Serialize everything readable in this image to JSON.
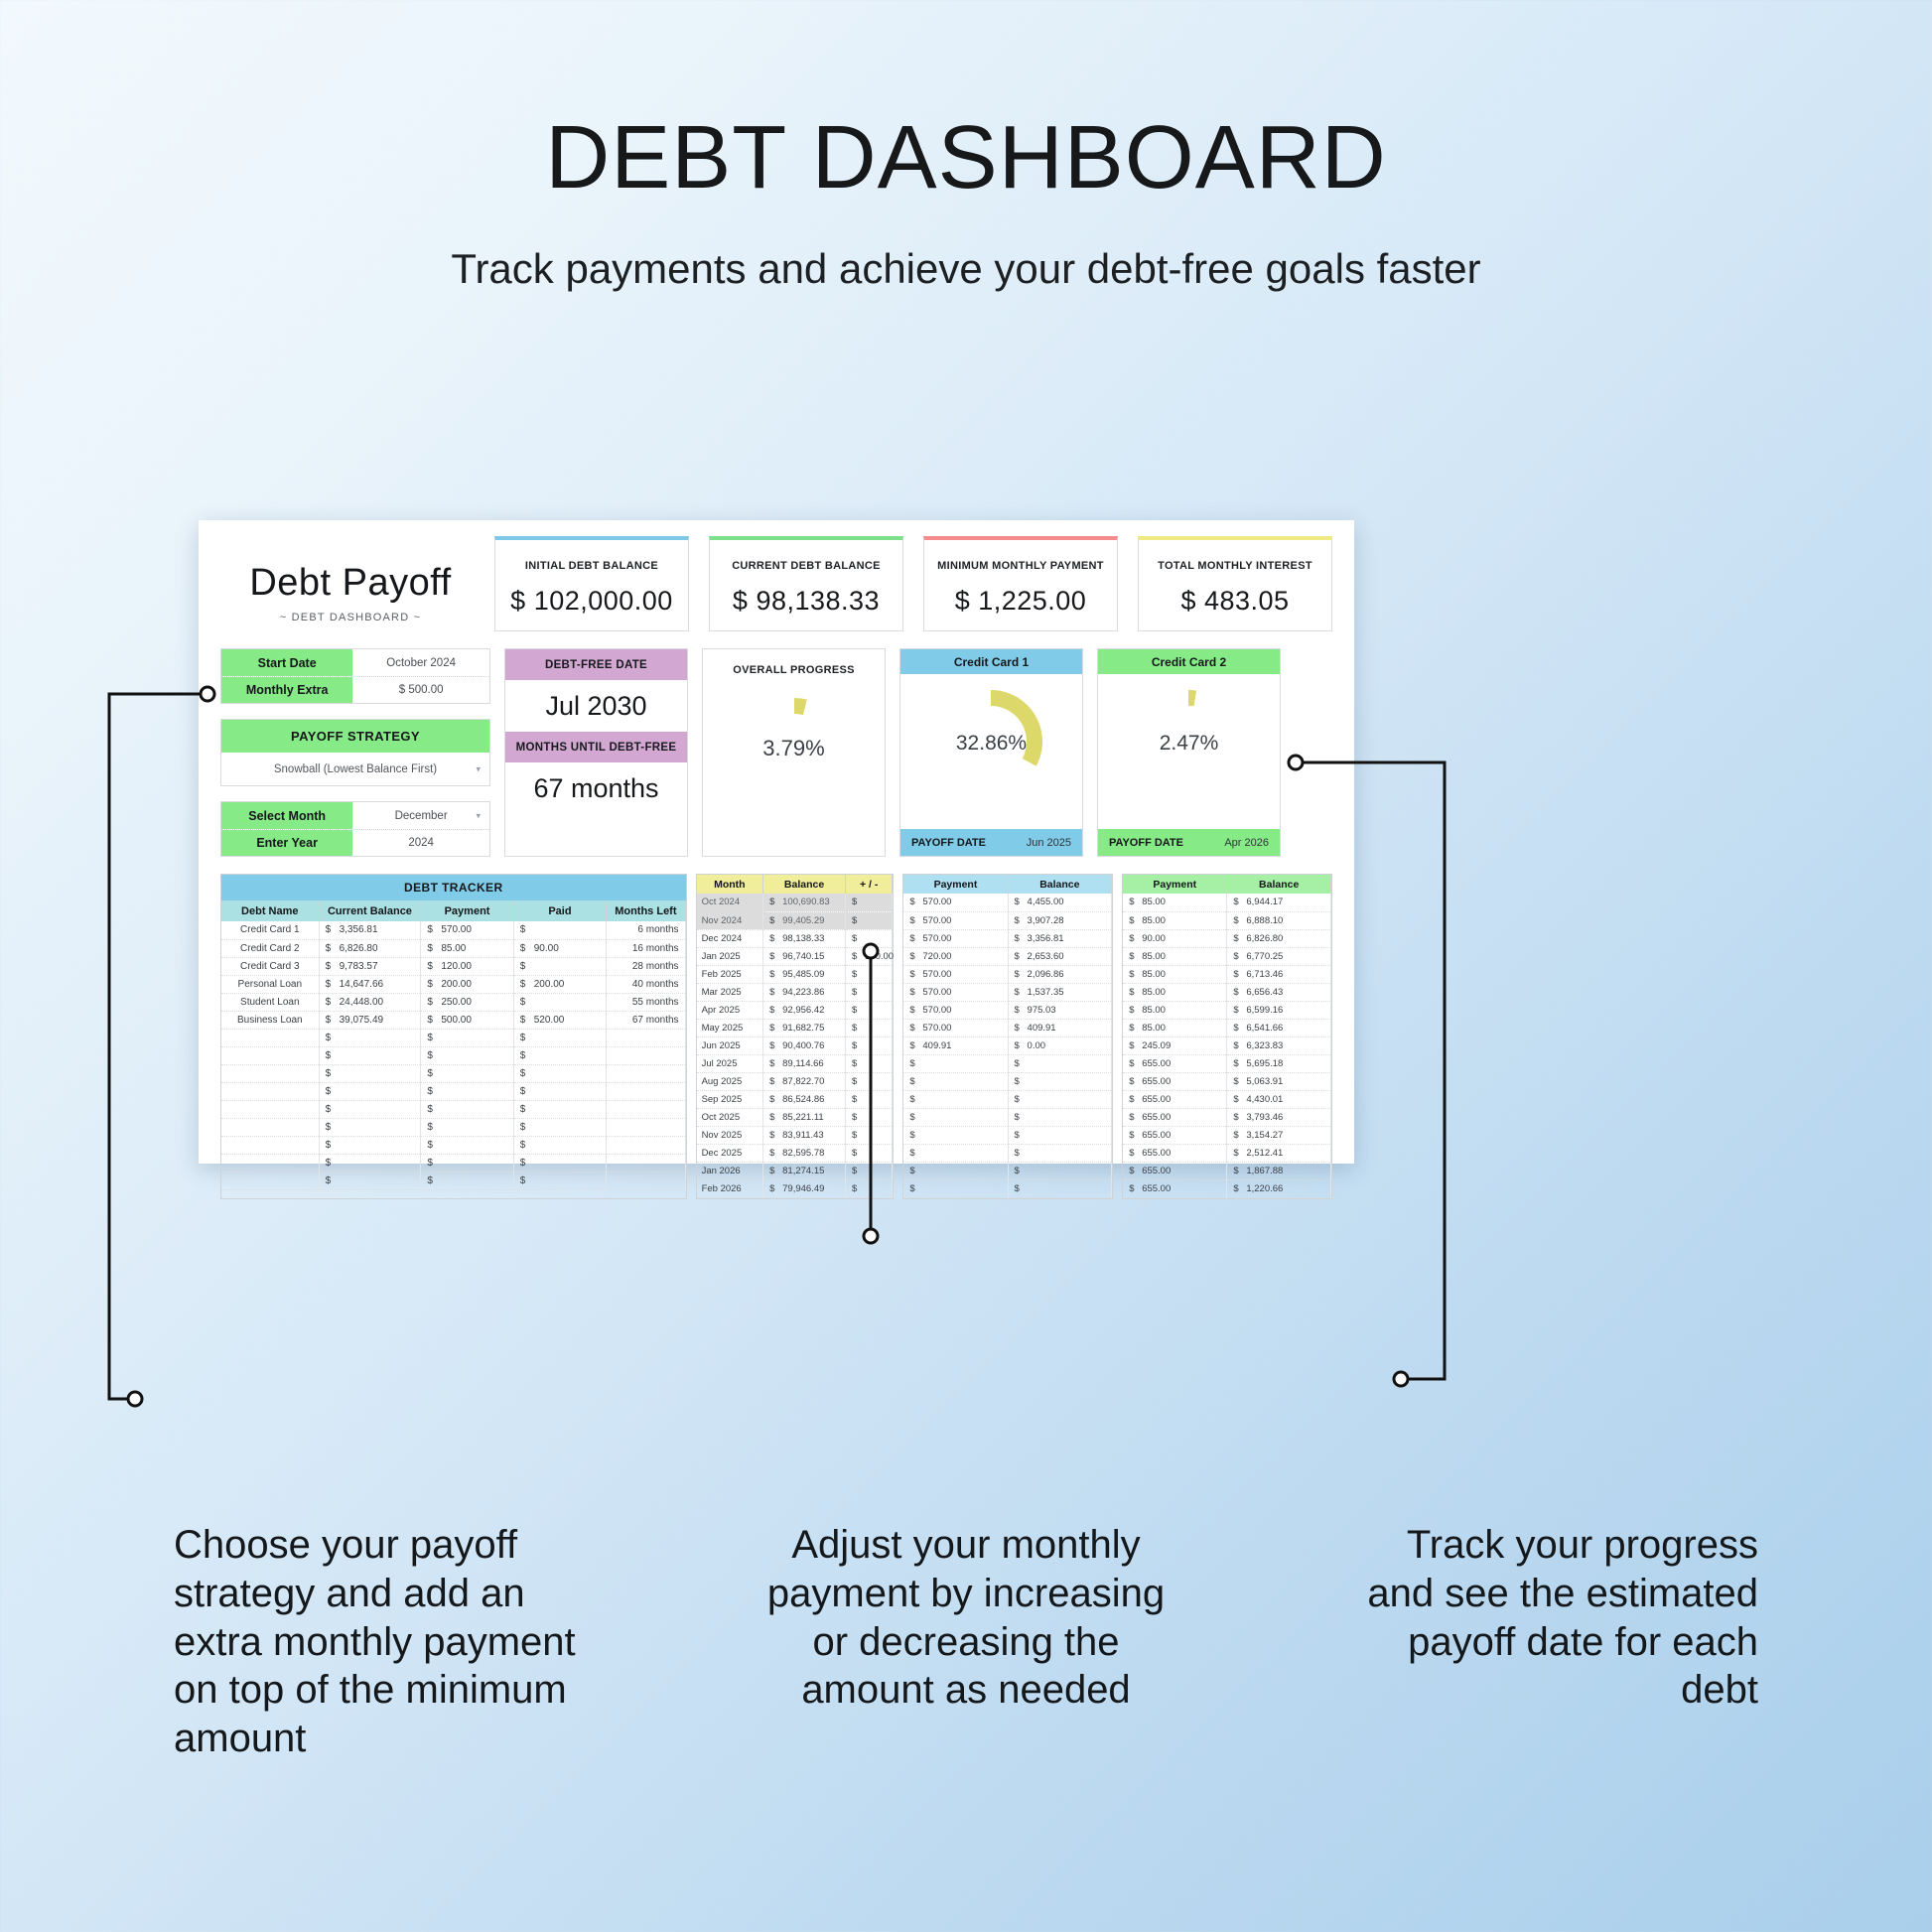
{
  "header": {
    "title": "DEBT DASHBOARD",
    "subtitle": "Track payments and achieve your debt-free goals faster"
  },
  "brand": {
    "name": "Debt Payoff",
    "tagline": "~ DEBT DASHBOARD ~"
  },
  "kpis": [
    {
      "label": "INITIAL DEBT BALANCE",
      "value": "$ 102,000.00",
      "accent": "#7ec8e8"
    },
    {
      "label": "CURRENT DEBT BALANCE",
      "value": "$ 98,138.33",
      "accent": "#7ee08a"
    },
    {
      "label": "MINIMUM MONTHLY PAYMENT",
      "value": "$ 1,225.00",
      "accent": "#f58b8b"
    },
    {
      "label": "TOTAL MONTHLY INTEREST",
      "value": "$ 483.05",
      "accent": "#eeeb82"
    }
  ],
  "controls": {
    "start_date_label": "Start Date",
    "start_date_value": "October 2024",
    "monthly_extra_label": "Monthly Extra",
    "monthly_extra_value": "$  500.00",
    "strategy_label": "PAYOFF STRATEGY",
    "strategy_value": "Snowball (Lowest Balance First)",
    "select_month_label": "Select Month",
    "select_month_value": "December",
    "enter_year_label": "Enter Year",
    "enter_year_value": "2024"
  },
  "debt_free": {
    "date_label": "DEBT-FREE DATE",
    "date_value": "Jul 2030",
    "months_label": "MONTHS UNTIL DEBT-FREE",
    "months_value": "67 months"
  },
  "overall_progress": {
    "label": "OVERALL PROGRESS",
    "value": "3.79%",
    "percent": 3.79
  },
  "cards": [
    {
      "name": "Credit Card 1",
      "percent_text": "32.86%",
      "percent": 32.86,
      "payoff_label": "PAYOFF DATE",
      "payoff_value": "Jun 2025",
      "color": "#80cbe8"
    },
    {
      "name": "Credit Card 2",
      "percent_text": "2.47%",
      "percent": 2.47,
      "payoff_label": "PAYOFF DATE",
      "payoff_value": "Apr 2026",
      "color": "#86ea86"
    }
  ],
  "tracker": {
    "title": "DEBT TRACKER",
    "columns": [
      "Debt Name",
      "Current Balance",
      "Payment",
      "Paid",
      "Months Left"
    ],
    "rows": [
      {
        "name": "Credit Card 1",
        "balance": "3,356.81",
        "payment": "570.00",
        "paid": "",
        "left": "6 months"
      },
      {
        "name": "Credit Card 2",
        "balance": "6,826.80",
        "payment": "85.00",
        "paid": "90.00",
        "left": "16 months"
      },
      {
        "name": "Credit Card 3",
        "balance": "9,783.57",
        "payment": "120.00",
        "paid": "",
        "left": "28 months"
      },
      {
        "name": "Personal Loan",
        "balance": "14,647.66",
        "payment": "200.00",
        "paid": "200.00",
        "left": "40 months"
      },
      {
        "name": "Student Loan",
        "balance": "24,448.00",
        "payment": "250.00",
        "paid": "",
        "left": "55 months"
      },
      {
        "name": "Business Loan",
        "balance": "39,075.49",
        "payment": "500.00",
        "paid": "520.00",
        "left": "67 months"
      },
      {
        "name": "",
        "balance": "",
        "payment": "",
        "paid": "",
        "left": ""
      },
      {
        "name": "",
        "balance": "",
        "payment": "",
        "paid": "",
        "left": ""
      },
      {
        "name": "",
        "balance": "",
        "payment": "",
        "paid": "",
        "left": ""
      },
      {
        "name": "",
        "balance": "",
        "payment": "",
        "paid": "",
        "left": ""
      },
      {
        "name": "",
        "balance": "",
        "payment": "",
        "paid": "",
        "left": ""
      },
      {
        "name": "",
        "balance": "",
        "payment": "",
        "paid": "",
        "left": ""
      },
      {
        "name": "",
        "balance": "",
        "payment": "",
        "paid": "",
        "left": ""
      },
      {
        "name": "",
        "balance": "",
        "payment": "",
        "paid": "",
        "left": ""
      },
      {
        "name": "",
        "balance": "",
        "payment": "",
        "paid": "",
        "left": ""
      }
    ]
  },
  "amortization": {
    "columns": [
      "Month",
      "Balance",
      "+ / -"
    ],
    "rows": [
      {
        "month": "Oct 2024",
        "balance": "100,690.83",
        "adj": "",
        "shaded": true
      },
      {
        "month": "Nov 2024",
        "balance": "99,405.29",
        "adj": "",
        "shaded": true
      },
      {
        "month": "Dec 2024",
        "balance": "98,138.33",
        "adj": "",
        "shaded": false
      },
      {
        "month": "Jan 2025",
        "balance": "96,740.15",
        "adj": "150.00",
        "shaded": false
      },
      {
        "month": "Feb 2025",
        "balance": "95,485.09",
        "adj": "",
        "shaded": false
      },
      {
        "month": "Mar 2025",
        "balance": "94,223.86",
        "adj": "",
        "shaded": false
      },
      {
        "month": "Apr 2025",
        "balance": "92,956.42",
        "adj": "",
        "shaded": false
      },
      {
        "month": "May 2025",
        "balance": "91,682.75",
        "adj": "",
        "shaded": false
      },
      {
        "month": "Jun 2025",
        "balance": "90,400.76",
        "adj": "",
        "shaded": false
      },
      {
        "month": "Jul 2025",
        "balance": "89,114.66",
        "adj": "",
        "shaded": false
      },
      {
        "month": "Aug 2025",
        "balance": "87,822.70",
        "adj": "",
        "shaded": false
      },
      {
        "month": "Sep 2025",
        "balance": "86,524.86",
        "adj": "",
        "shaded": false
      },
      {
        "month": "Oct 2025",
        "balance": "85,221.11",
        "adj": "",
        "shaded": false
      },
      {
        "month": "Nov 2025",
        "balance": "83,911.43",
        "adj": "",
        "shaded": false
      },
      {
        "month": "Dec 2025",
        "balance": "82,595.78",
        "adj": "",
        "shaded": false
      },
      {
        "month": "Jan 2026",
        "balance": "81,274.15",
        "adj": "",
        "shaded": false
      },
      {
        "month": "Feb 2026",
        "balance": "79,946.49",
        "adj": "",
        "shaded": false
      }
    ]
  },
  "card1_schedule": {
    "columns": [
      "Payment",
      "Balance"
    ],
    "rows": [
      {
        "payment": "570.00",
        "balance": "4,455.00"
      },
      {
        "payment": "570.00",
        "balance": "3,907.28"
      },
      {
        "payment": "570.00",
        "balance": "3,356.81"
      },
      {
        "payment": "720.00",
        "balance": "2,653.60"
      },
      {
        "payment": "570.00",
        "balance": "2,096.86"
      },
      {
        "payment": "570.00",
        "balance": "1,537.35"
      },
      {
        "payment": "570.00",
        "balance": "975.03"
      },
      {
        "payment": "570.00",
        "balance": "409.91"
      },
      {
        "payment": "409.91",
        "balance": "0.00"
      },
      {
        "payment": "",
        "balance": ""
      },
      {
        "payment": "",
        "balance": ""
      },
      {
        "payment": "",
        "balance": ""
      },
      {
        "payment": "",
        "balance": ""
      },
      {
        "payment": "",
        "balance": ""
      },
      {
        "payment": "",
        "balance": ""
      },
      {
        "payment": "",
        "balance": ""
      },
      {
        "payment": "",
        "balance": ""
      }
    ]
  },
  "card2_schedule": {
    "columns": [
      "Payment",
      "Balance"
    ],
    "rows": [
      {
        "payment": "85.00",
        "balance": "6,944.17"
      },
      {
        "payment": "85.00",
        "balance": "6,888.10"
      },
      {
        "payment": "90.00",
        "balance": "6,826.80"
      },
      {
        "payment": "85.00",
        "balance": "6,770.25"
      },
      {
        "payment": "85.00",
        "balance": "6,713.46"
      },
      {
        "payment": "85.00",
        "balance": "6,656.43"
      },
      {
        "payment": "85.00",
        "balance": "6,599.16"
      },
      {
        "payment": "85.00",
        "balance": "6,541.66"
      },
      {
        "payment": "245.09",
        "balance": "6,323.83"
      },
      {
        "payment": "655.00",
        "balance": "5,695.18"
      },
      {
        "payment": "655.00",
        "balance": "5,063.91"
      },
      {
        "payment": "655.00",
        "balance": "4,430.01"
      },
      {
        "payment": "655.00",
        "balance": "3,793.46"
      },
      {
        "payment": "655.00",
        "balance": "3,154.27"
      },
      {
        "payment": "655.00",
        "balance": "2,512.41"
      },
      {
        "payment": "655.00",
        "balance": "1,867.88"
      },
      {
        "payment": "655.00",
        "balance": "1,220.66"
      }
    ]
  },
  "callouts": [
    "Choose your payoff strategy and add an extra monthly payment on top of the minimum amount",
    "Adjust your monthly payment by increasing or decreasing the amount as needed",
    "Track your progress and see the estimated payoff date for each debt"
  ],
  "colors": {
    "gauge_fill": "#dcd96a",
    "green": "#86ea86",
    "blue": "#80cbe8",
    "purple": "#d2a8d2",
    "yellow_header": "#f0ee9a"
  }
}
